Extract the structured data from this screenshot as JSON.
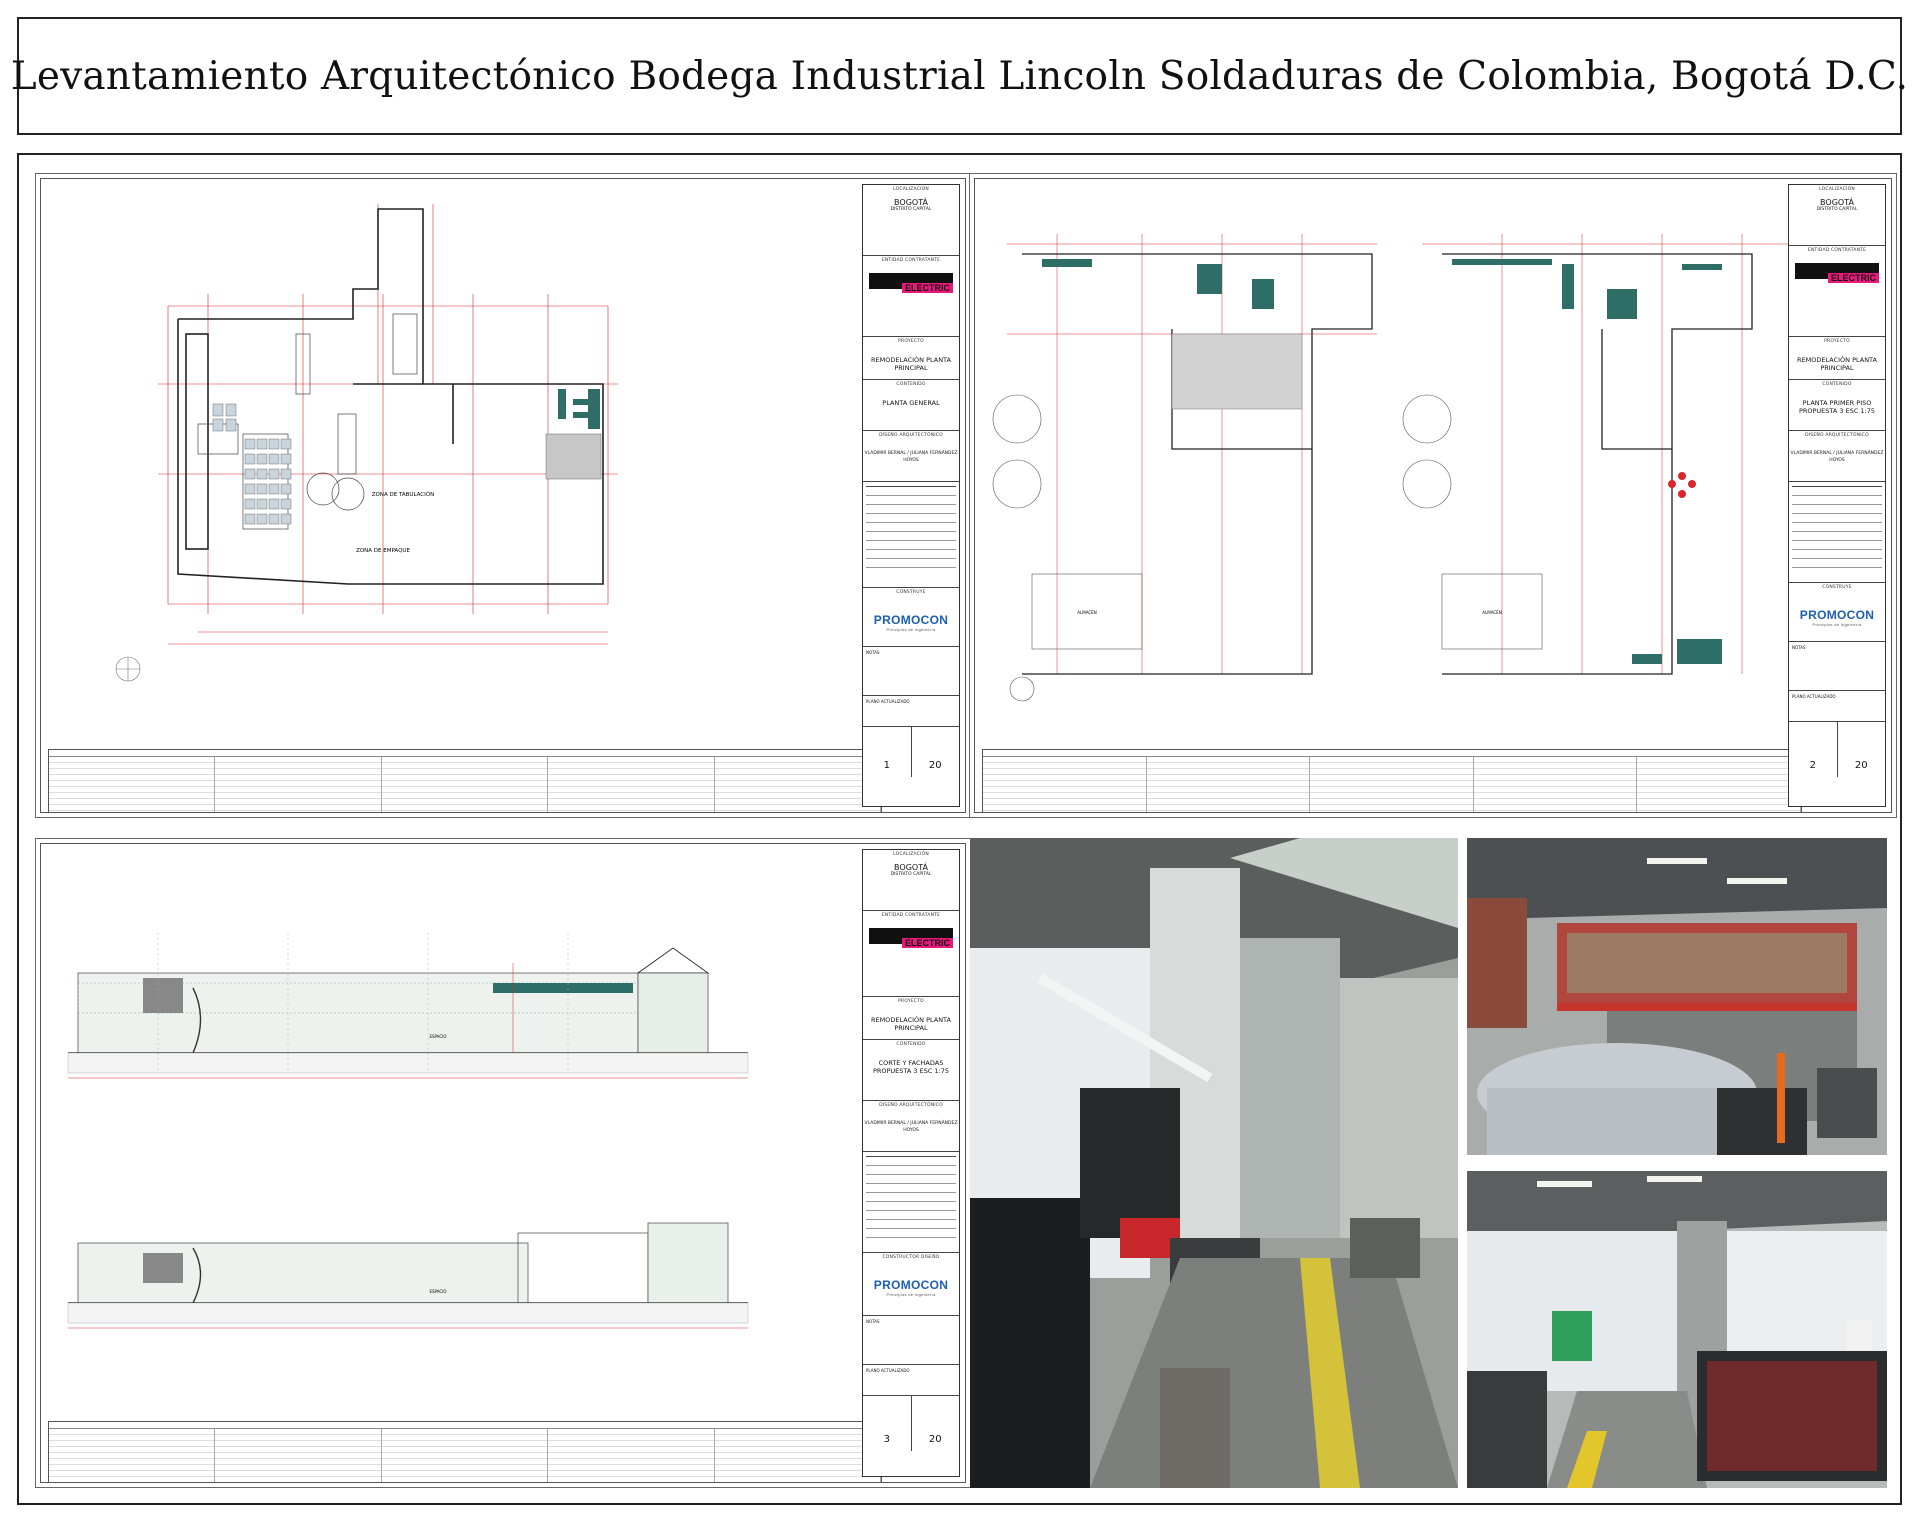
{
  "header": {
    "title": "Levantamiento Arquitectónico Bodega Industrial Lincoln Soldaduras de Colombia, Bogotá D.C."
  },
  "sheets": [
    {
      "city": "BOGOTÁ",
      "city_sub": "DISTRITO CAPITAL",
      "brand": "ELECTRIC",
      "project": "REMODELACIÓN PLANTA PRINCIPAL",
      "content": "PLANTA GENERAL",
      "designers": "VLADIMIR BERNAL / JULIANA FERNÁNDEZ HOYOS",
      "firm": "PROMOCON",
      "firm_sub": "Principios de Ingeniería",
      "sheet_no": "1",
      "sheet_total": "20"
    },
    {
      "city": "BOGOTÁ",
      "city_sub": "DISTRITO CAPITAL",
      "brand": "ELECTRIC",
      "project": "REMODELACIÓN PLANTA PRINCIPAL",
      "content": "PLANTA PRIMER PISO PROPUESTA 3 ESC 1:75",
      "designers": "VLADIMIR BERNAL / JULIANA FERNÁNDEZ HOYOS",
      "firm": "PROMOCON",
      "firm_sub": "Principios de Ingeniería",
      "sheet_no": "2",
      "sheet_total": "20"
    },
    {
      "city": "BOGOTÁ",
      "city_sub": "DISTRITO CAPITAL",
      "brand": "ELECTRIC",
      "project": "REMODELACIÓN PLANTA PRINCIPAL",
      "content": "CORTE Y FACHADAS PROPUESTA 3 ESC 1:75",
      "designers": "VLADIMIR BERNAL / JULIANA FERNÁNDEZ HOYOS",
      "firm": "PROMOCON",
      "firm_sub": "Principios de Ingeniería",
      "sheet_no": "3",
      "sheet_total": "20"
    }
  ],
  "plan_labels": {
    "zona_tabulacion": "ZONA DE TABULACIÓN",
    "zona_empaque": "ZONA DE EMPAQUE",
    "almacen": "ALMACÉN",
    "espacio": "ESPACIO"
  },
  "colors": {
    "frame": "#222222",
    "dimension_red": "#d9262c",
    "wall_teal": "#2e6e66",
    "brand_pink": "#e8197a",
    "firm_blue": "#1d5fb0"
  },
  "photos": [
    {
      "subject": "welding-workshop-interior"
    },
    {
      "subject": "mezzanine-storage-with-car"
    },
    {
      "subject": "warehouse-cages-and-ramp"
    }
  ]
}
